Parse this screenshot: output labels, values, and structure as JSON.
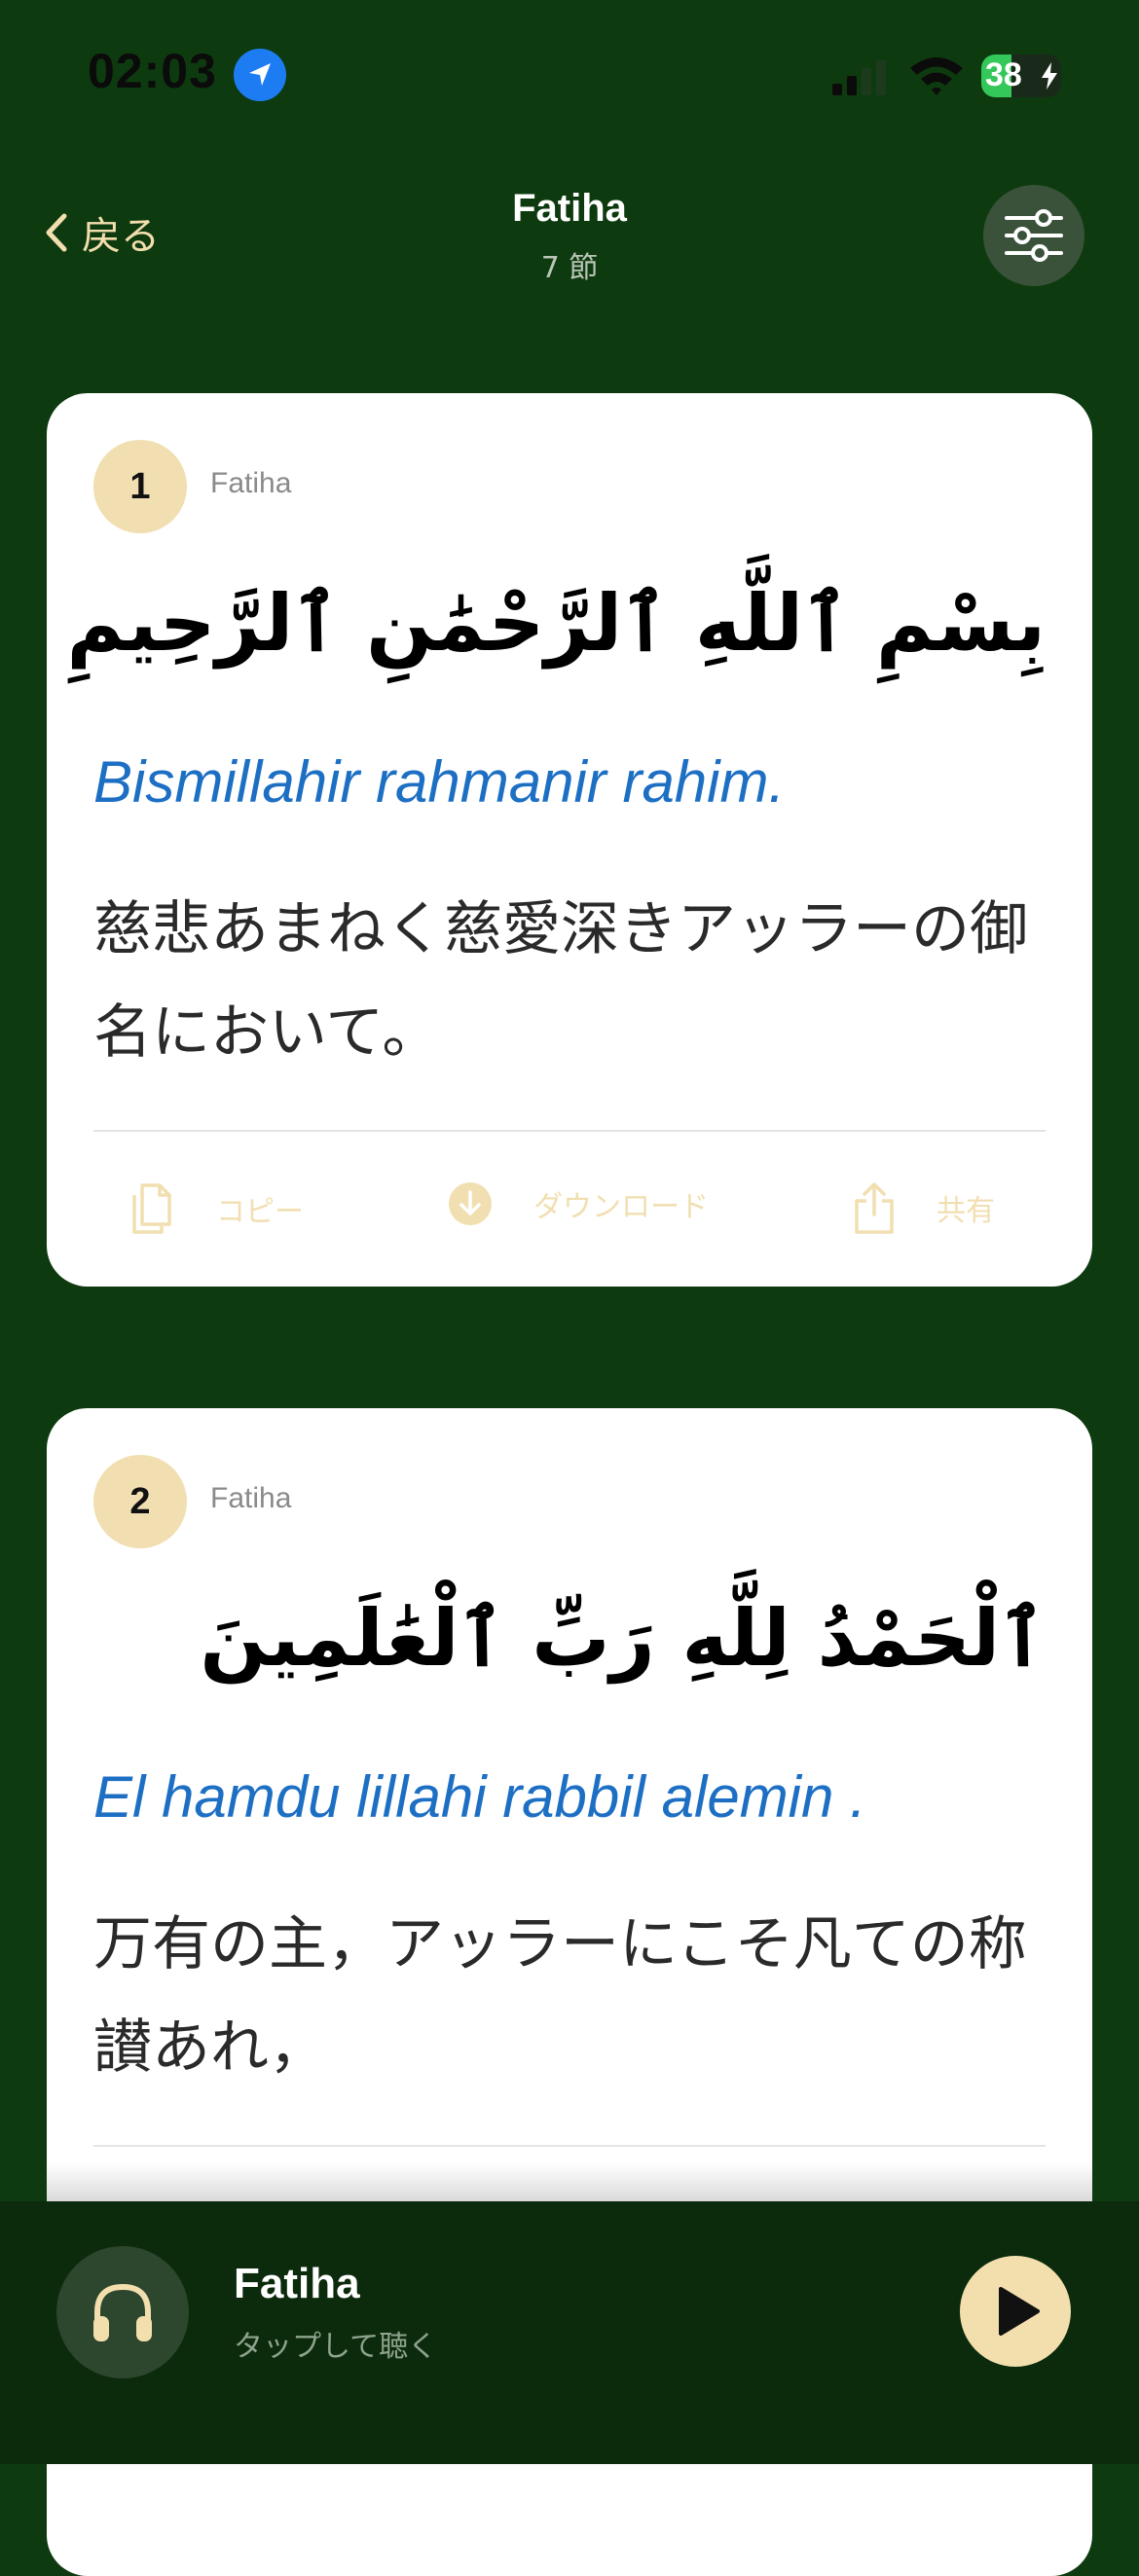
{
  "status_bar": {
    "time": "02:03",
    "battery_text": "38",
    "battery_level": 0.38
  },
  "nav": {
    "back_label": "戻る",
    "title": "Fatiha",
    "subtitle": "7 節"
  },
  "verses": [
    {
      "number": "1",
      "surah": "Fatiha",
      "arabic": "بِسْمِ ٱللَّهِ ٱلرَّحْمَٰنِ ٱلرَّحِيمِ",
      "transliteration": "Bismillahir rahmanir rahim.",
      "translation": "慈悲あまねく慈愛深きアッラーの御名において。"
    },
    {
      "number": "2",
      "surah": "Fatiha",
      "arabic": "ٱلْحَمْدُ لِلَّهِ رَبِّ ٱلْعَٰلَمِينَ",
      "transliteration": "El hamdu lillahi rabbil alemin .",
      "translation": "万有の主，アッラーにこそ凡ての称讃あれ，"
    }
  ],
  "actions": {
    "copy": "コピー",
    "download": "ダウンロード",
    "share": "共有"
  },
  "player": {
    "title": "Fatiha",
    "subtitle": "タップして聴く"
  },
  "colors": {
    "background": "#0e3a0f",
    "accent": "#f3dfae",
    "transliteration": "#1d6fc4"
  },
  "icons": [
    "location-arrow-icon",
    "signal-icon",
    "wifi-icon",
    "battery-icon",
    "chevron-left-icon",
    "sliders-icon",
    "copy-icon",
    "download-icon",
    "share-icon",
    "headphones-icon",
    "play-icon"
  ]
}
